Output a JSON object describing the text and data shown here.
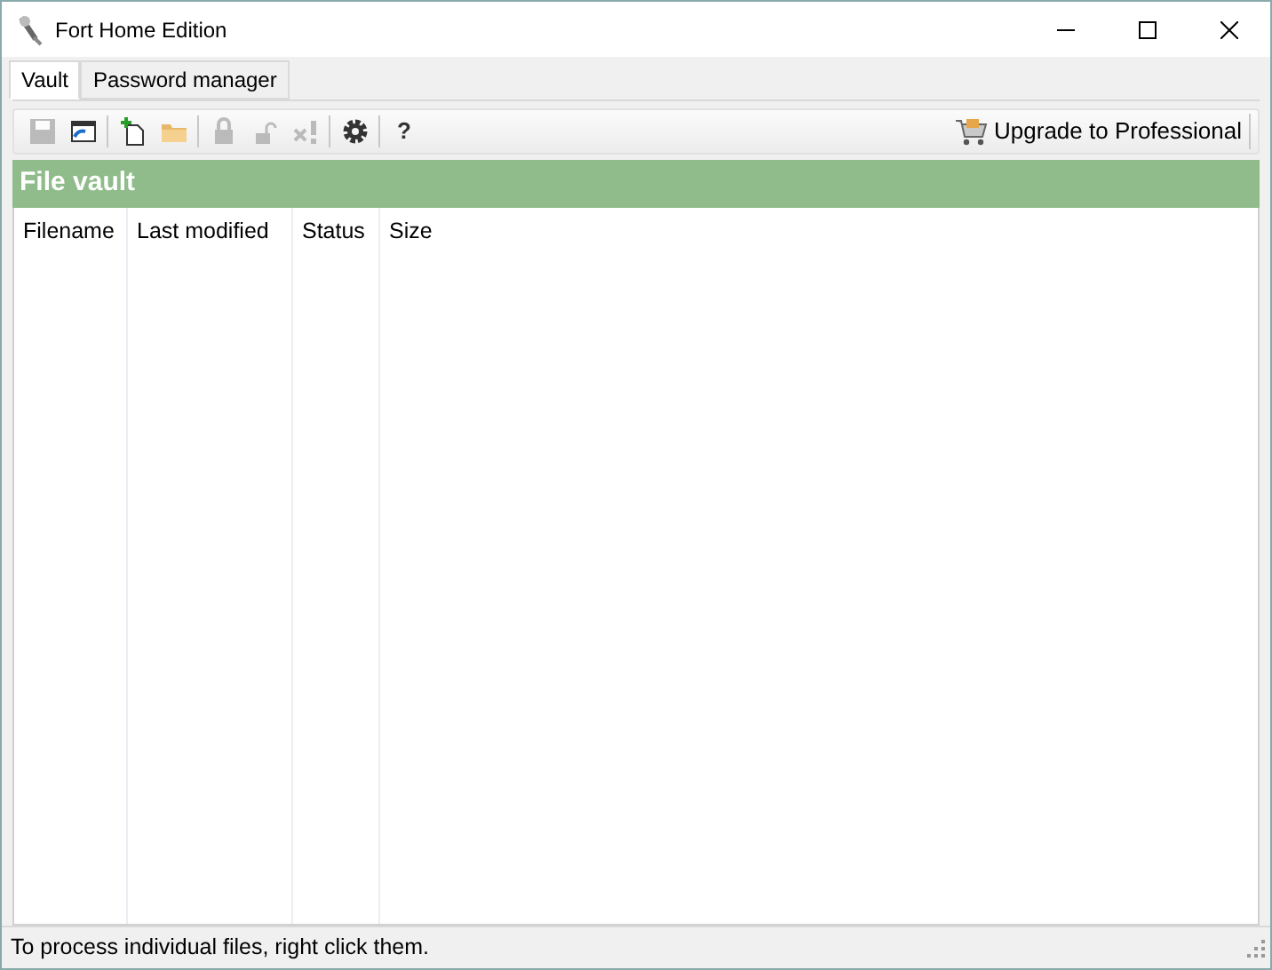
{
  "window": {
    "title": "Fort Home Edition"
  },
  "tabs": [
    {
      "label": "Vault",
      "selected": true
    },
    {
      "label": "Password manager",
      "selected": false
    }
  ],
  "toolbar": [
    {
      "kind": "save",
      "disabled": true
    },
    {
      "kind": "window",
      "disabled": false
    },
    {
      "kind": "separator"
    },
    {
      "kind": "new",
      "disabled": false
    },
    {
      "kind": "folder",
      "disabled": false
    },
    {
      "kind": "separator"
    },
    {
      "kind": "lock",
      "disabled": true
    },
    {
      "kind": "unlock",
      "disabled": true
    },
    {
      "kind": "remove",
      "disabled": true
    },
    {
      "kind": "separator"
    },
    {
      "kind": "settings",
      "disabled": false
    },
    {
      "kind": "separator"
    },
    {
      "kind": "help",
      "label": "?",
      "disabled": false
    }
  ],
  "upgrade_button": {
    "label": "Upgrade to Professional"
  },
  "panel": {
    "title": "File vault"
  },
  "table": {
    "columns": [
      "Filename",
      "Last modified",
      "Status",
      "Size"
    ]
  },
  "status_bar": "To process individual files, right click them."
}
